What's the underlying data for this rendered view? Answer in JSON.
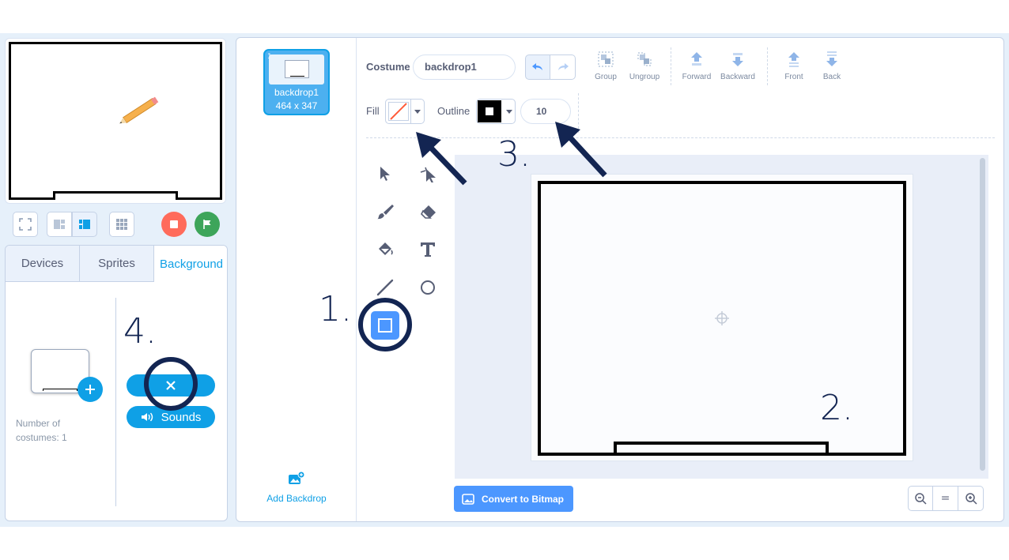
{
  "stage": {
    "ledge": true
  },
  "left_panel": {
    "tabs": [
      {
        "label": "Devices"
      },
      {
        "label": "Sprites"
      },
      {
        "label": "Background"
      }
    ],
    "costume_count_label": "Number of costumes: 1",
    "sounds_label": "Sounds"
  },
  "costume_list": {
    "index": "1",
    "name": "backdrop1",
    "size": "464 x 347",
    "add_backdrop": "Add Backdrop"
  },
  "editor": {
    "costume_label": "Costume",
    "costume_name": "backdrop1",
    "fill_label": "Fill",
    "outline_label": "Outline",
    "outline_width": "10",
    "toolbar": {
      "group": "Group",
      "ungroup": "Ungroup",
      "forward": "Forward",
      "backward": "Backward",
      "front": "Front",
      "back": "Back"
    },
    "convert_label": "Convert to Bitmap",
    "zoom_reset": "="
  },
  "annotations": {
    "n1": "1.",
    "n2": "2.",
    "n3": "3.",
    "n4": "4."
  },
  "colors": {
    "accent": "#0fa0e6",
    "selected_tool": "#4c97ff",
    "stop": "#ff6b5b",
    "go": "#3da55a",
    "annotation": "#132552"
  }
}
